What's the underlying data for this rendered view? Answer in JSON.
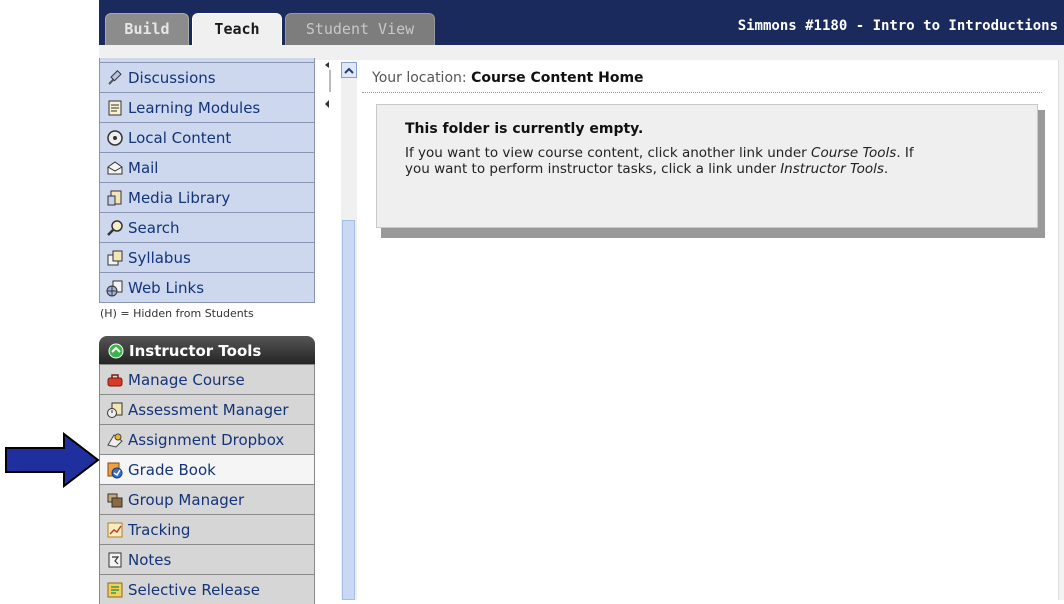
{
  "header": {
    "tabs": [
      {
        "label": "Build"
      },
      {
        "label": "Teach"
      },
      {
        "label": "Student View"
      }
    ],
    "course_title": "Simmons #1180 - Intro to Introductions"
  },
  "sidebar": {
    "course_items": [
      {
        "label": "Discussions",
        "icon": "pin-icon"
      },
      {
        "label": "Learning Modules",
        "icon": "document-icon"
      },
      {
        "label": "Local Content",
        "icon": "target-icon"
      },
      {
        "label": "Mail",
        "icon": "mail-icon"
      },
      {
        "label": "Media Library",
        "icon": "media-icon"
      },
      {
        "label": "Search",
        "icon": "search-icon"
      },
      {
        "label": "Syllabus",
        "icon": "syllabus-icon"
      },
      {
        "label": "Web Links",
        "icon": "globe-icon"
      }
    ],
    "hidden_note": "(H) = Hidden from Students",
    "instructor_header": "Instructor Tools",
    "instructor_items": [
      {
        "label": "Manage Course",
        "icon": "toolbox-icon"
      },
      {
        "label": "Assessment Manager",
        "icon": "assessment-icon"
      },
      {
        "label": "Assignment Dropbox",
        "icon": "dropbox-icon"
      },
      {
        "label": "Grade Book",
        "icon": "gradebook-icon",
        "active": true
      },
      {
        "label": "Group Manager",
        "icon": "group-icon"
      },
      {
        "label": "Tracking",
        "icon": "chart-icon"
      },
      {
        "label": "Notes",
        "icon": "notes-icon"
      },
      {
        "label": "Selective Release",
        "icon": "release-icon"
      }
    ]
  },
  "main": {
    "location_prefix": "Your location:",
    "location_value": "Course Content Home",
    "message": {
      "heading": "This folder is currently empty.",
      "body_part1": "If you want to view course content, click another link under ",
      "body_em1": "Course Tools",
      "body_part2": ". If you want to perform instructor tasks, click a link under ",
      "body_em2": "Instructor Tools",
      "body_part3": "."
    }
  },
  "colors": {
    "header_bg": "#1a2a5c",
    "course_item_bg": "#cdd7ee",
    "instructor_item_bg": "#d6d6d6",
    "arrow": "#1f2f9e"
  }
}
